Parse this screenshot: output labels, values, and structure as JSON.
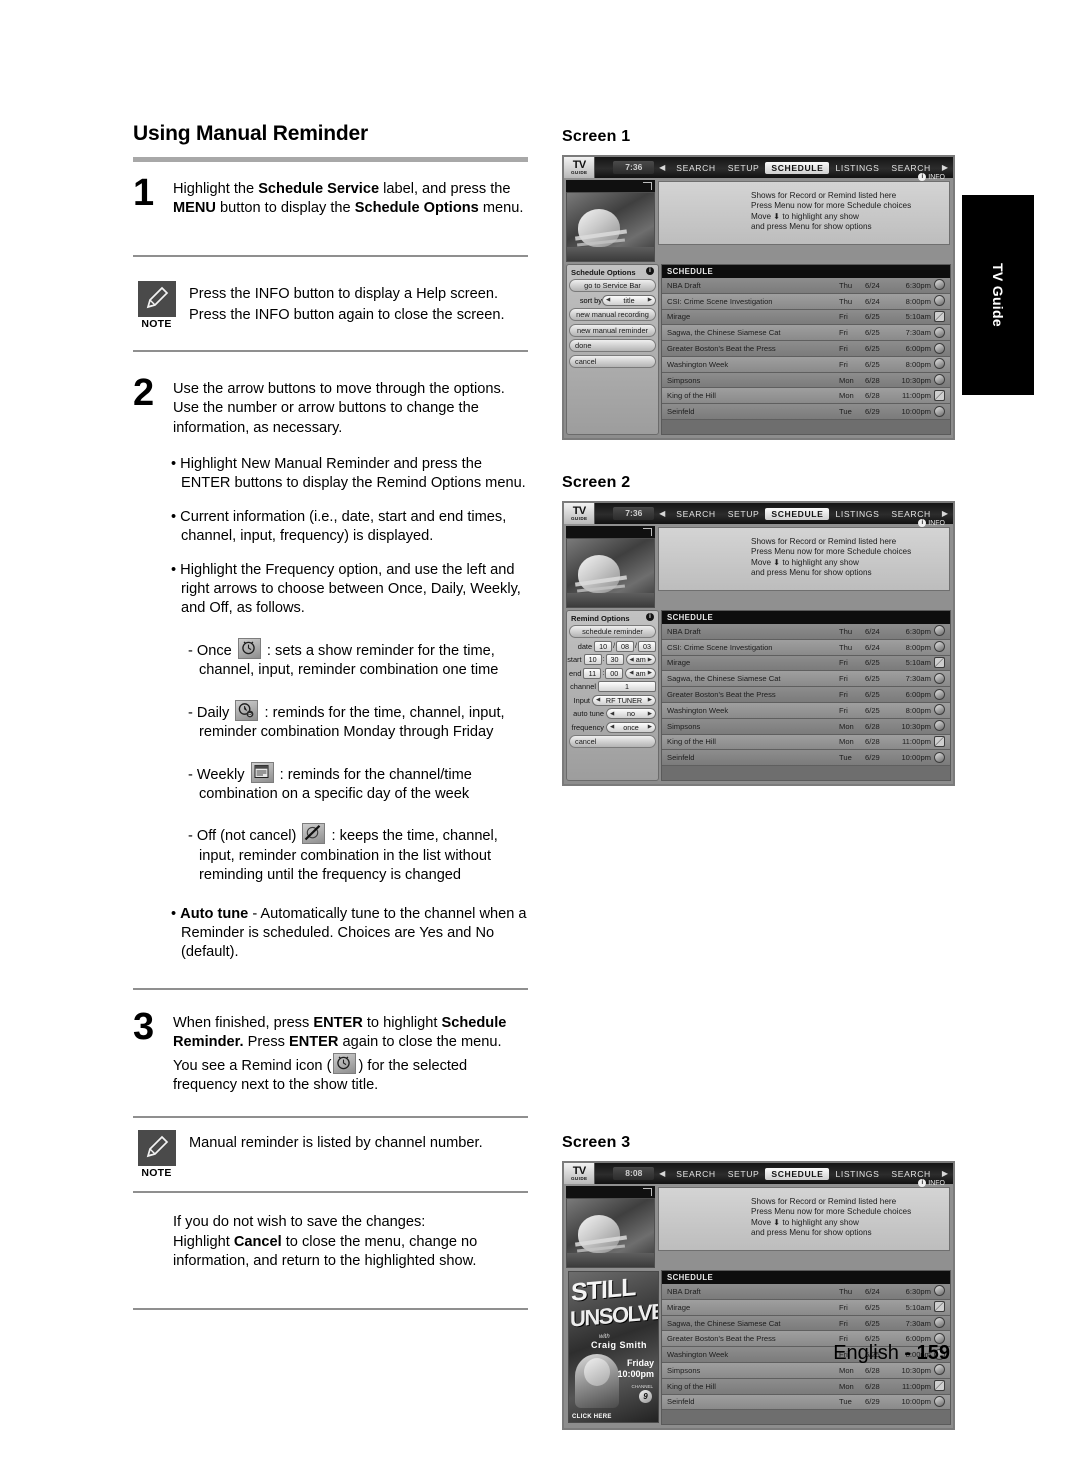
{
  "page": {
    "title": "Using Manual Reminder",
    "footer_language": "English",
    "footer_separator": "-",
    "footer_page": "159",
    "side_tab": "TV Guide"
  },
  "steps": {
    "one": {
      "number": "1",
      "text_parts": [
        "Highlight the ",
        "Schedule Service",
        " label, and press the ",
        "MENU",
        " button to display the ",
        "Schedule Options",
        " menu."
      ]
    },
    "two": {
      "number": "2",
      "intro": "Use the arrow buttons to move through the options. Use the number or arrow buttons to change the information, as necessary.",
      "bullets": [
        "Highlight New Manual Reminder and press the ENTER buttons to display the Remind Options menu.",
        "Current information (i.e., date, start and end times, channel, input, frequency) is displayed.",
        "Highlight the Frequency option, and use the left and right arrows to choose between Once, Daily, Weekly, and Off, as follows."
      ],
      "frequency_items": [
        {
          "label": "- Once",
          "icon": "clock-once-icon",
          "desc": ": sets a show reminder for the time, channel, input, reminder combination one time"
        },
        {
          "label": "- Daily",
          "icon": "clock-daily-icon",
          "desc": ": reminds for the time, channel, input, reminder combination Monday through Friday"
        },
        {
          "label": "- Weekly",
          "icon": "calendar-weekly-icon",
          "desc": ": reminds for the channel/time combination on a specific day of the week"
        },
        {
          "label": "- Off (not cancel)",
          "icon": "clock-off-icon",
          "desc": ": keeps the time, channel, input, reminder combination in the list without reminding until the frequency is changed"
        }
      ],
      "autotune_label": "Auto tune",
      "autotune_text": "-  Automatically tune to the channel when a Reminder is scheduled. Choices are Yes and No (default)."
    },
    "three": {
      "number": "3",
      "part1": "When finished, press ",
      "enter1": "ENTER",
      "part2": " to highlight ",
      "bold1": "Schedule Reminder.",
      "part3": " Press ",
      "enter2": "ENTER",
      "part4": " again to close the menu. You see a Remind icon (",
      "part5": ") for the selected frequency next to the show title."
    }
  },
  "notes": {
    "label": "NOTE",
    "note1": "Press the INFO button to display a Help screen. Press the INFO button again to close the screen.",
    "note2": "Manual reminder is listed by channel number."
  },
  "cancel_block": {
    "line1": "If you do not wish to save the changes:",
    "line2_a": "Highlight ",
    "line2_bold": "Cancel",
    "line2_b": " to close the menu, change no information, and return to the highlighted show."
  },
  "screens": [
    {
      "label": "Screen 1",
      "clock": "7:36",
      "nav": [
        "SEARCH",
        "SETUP",
        "SCHEDULE",
        "LISTINGS",
        "SEARCH"
      ],
      "nav_selected": "SCHEDULE",
      "info_chip": "INFO",
      "help_lines": [
        "Shows for Record or Remind listed here",
        "Press Menu now for more Schedule choices",
        "Move ⬇ to highlight any show",
        "and press Menu for show options"
      ],
      "panel": {
        "type": "schedule-options",
        "title": "Schedule Options",
        "buttons": [
          "go to Service Bar",
          "new manual recording",
          "new manual reminder",
          "done",
          "cancel"
        ],
        "sort_label": "sort by",
        "sort_value": "title"
      },
      "schedule_header": "SCHEDULE",
      "rows": [
        {
          "title": "NBA Draft",
          "day": "Thu",
          "date": "6/24",
          "time": "6:30pm",
          "icon": "remind-once-icon"
        },
        {
          "title": "CSI: Crime Scene Investigation",
          "day": "Thu",
          "date": "6/24",
          "time": "8:00pm",
          "icon": "remind-once-icon"
        },
        {
          "title": "Mirage",
          "day": "Fri",
          "date": "6/25",
          "time": "5:10am",
          "icon": "remind-off-icon"
        },
        {
          "title": "Sagwa, the Chinese Siamese Cat",
          "day": "Fri",
          "date": "6/25",
          "time": "7:30am",
          "icon": "remind-daily-icon"
        },
        {
          "title": "Greater Boston's Beat the Press",
          "day": "Fri",
          "date": "6/25",
          "time": "6:00pm",
          "icon": "remind-once-icon"
        },
        {
          "title": "Washington Week",
          "day": "Fri",
          "date": "6/25",
          "time": "8:00pm",
          "icon": "remind-weekly-icon"
        },
        {
          "title": "Simpsons",
          "day": "Mon",
          "date": "6/28",
          "time": "10:30pm",
          "icon": "remind-daily-icon"
        },
        {
          "title": "King of the Hill",
          "day": "Mon",
          "date": "6/28",
          "time": "11:00pm",
          "icon": "remind-off-icon"
        },
        {
          "title": "Seinfeld",
          "day": "Tue",
          "date": "6/29",
          "time": "10:00pm",
          "icon": "remind-daily-icon"
        }
      ]
    },
    {
      "label": "Screen 2",
      "clock": "7:36",
      "nav": [
        "SEARCH",
        "SETUP",
        "SCHEDULE",
        "LISTINGS",
        "SEARCH"
      ],
      "nav_selected": "SCHEDULE",
      "info_chip": "INFO",
      "help_lines": [
        "Shows for Record or Remind listed here",
        "Press Menu now for more Schedule choices",
        "Move ⬇ to highlight any show",
        "and press Menu for show options"
      ],
      "panel": {
        "type": "remind-options",
        "title": "Remind Options",
        "schedule_button": "schedule reminder",
        "cancel_button": "cancel",
        "fields": [
          {
            "name": "date",
            "label": "date",
            "values": [
              "10",
              "08",
              "03"
            ]
          },
          {
            "name": "start",
            "label": "start",
            "values": [
              "10",
              "30",
              "am"
            ]
          },
          {
            "name": "end",
            "label": "end",
            "values": [
              "11",
              "00",
              "am"
            ]
          },
          {
            "name": "channel",
            "label": "channel",
            "values": [
              "1"
            ]
          },
          {
            "name": "input",
            "label": "Input",
            "values": [
              "RF TUNER"
            ]
          },
          {
            "name": "auto-tune",
            "label": "auto tune",
            "values": [
              "no"
            ]
          },
          {
            "name": "frequency",
            "label": "frequency",
            "values": [
              "once"
            ]
          }
        ]
      },
      "schedule_header": "SCHEDULE",
      "rows": [
        {
          "title": "NBA Draft",
          "day": "Thu",
          "date": "6/24",
          "time": "6:30pm",
          "icon": "remind-once-icon"
        },
        {
          "title": "CSI: Crime Scene Investigation",
          "day": "Thu",
          "date": "6/24",
          "time": "8:00pm",
          "icon": "remind-once-icon"
        },
        {
          "title": "Mirage",
          "day": "Fri",
          "date": "6/25",
          "time": "5:10am",
          "icon": "remind-off-icon"
        },
        {
          "title": "Sagwa, the Chinese Siamese Cat",
          "day": "Fri",
          "date": "6/25",
          "time": "7:30am",
          "icon": "remind-daily-icon"
        },
        {
          "title": "Greater Boston's Beat the Press",
          "day": "Fri",
          "date": "6/25",
          "time": "6:00pm",
          "icon": "remind-once-icon"
        },
        {
          "title": "Washington Week",
          "day": "Fri",
          "date": "6/25",
          "time": "8:00pm",
          "icon": "remind-weekly-icon"
        },
        {
          "title": "Simpsons",
          "day": "Mon",
          "date": "6/28",
          "time": "10:30pm",
          "icon": "remind-daily-icon"
        },
        {
          "title": "King of the Hill",
          "day": "Mon",
          "date": "6/28",
          "time": "11:00pm",
          "icon": "remind-off-icon"
        },
        {
          "title": "Seinfeld",
          "day": "Tue",
          "date": "6/29",
          "time": "10:00pm",
          "icon": "remind-daily-icon"
        }
      ]
    },
    {
      "label": "Screen 3",
      "clock": "8:08",
      "nav": [
        "SEARCH",
        "SETUP",
        "SCHEDULE",
        "LISTINGS",
        "SEARCH"
      ],
      "nav_selected": "SCHEDULE",
      "info_chip": "INFO",
      "help_lines": [
        "Shows for Record or Remind listed here",
        "Press Menu now for more Schedule choices",
        "Move ⬇ to highlight any show",
        "and press Menu for show options"
      ],
      "panel": {
        "type": "advertisement",
        "line1": "STILL",
        "line2": "UNSOLVED",
        "with": "with",
        "host": "Craig Smith",
        "day": "Friday",
        "time": "10:00pm",
        "channel_label": "CHANNEL",
        "channel_number": "9",
        "click": "CLICK HERE"
      },
      "schedule_header": "SCHEDULE",
      "rows": [
        {
          "title": "NBA Draft",
          "day": "Thu",
          "date": "6/24",
          "time": "6:30pm",
          "icon": "remind-once-icon"
        },
        {
          "title": "Mirage",
          "day": "Fri",
          "date": "6/25",
          "time": "5:10am",
          "icon": "remind-off-icon"
        },
        {
          "title": "Sagwa, the Chinese Siamese Cat",
          "day": "Fri",
          "date": "6/25",
          "time": "7:30am",
          "icon": "remind-daily-icon"
        },
        {
          "title": "Greater Boston's Beat the Press",
          "day": "Fri",
          "date": "6/25",
          "time": "6:00pm",
          "icon": "remind-once-icon"
        },
        {
          "title": "Washington Week",
          "day": "Fri",
          "date": "6/25",
          "time": "8:00pm",
          "icon": "remind-weekly-icon"
        },
        {
          "title": "Simpsons",
          "day": "Mon",
          "date": "6/28",
          "time": "10:30pm",
          "icon": "remind-daily-icon"
        },
        {
          "title": "King of the Hill",
          "day": "Mon",
          "date": "6/28",
          "time": "11:00pm",
          "icon": "remind-off-icon"
        },
        {
          "title": "Seinfeld",
          "day": "Tue",
          "date": "6/29",
          "time": "10:00pm",
          "icon": "remind-daily-icon"
        }
      ]
    }
  ],
  "tv_logo": {
    "top": "TV",
    "bottom": "GUIDE"
  }
}
